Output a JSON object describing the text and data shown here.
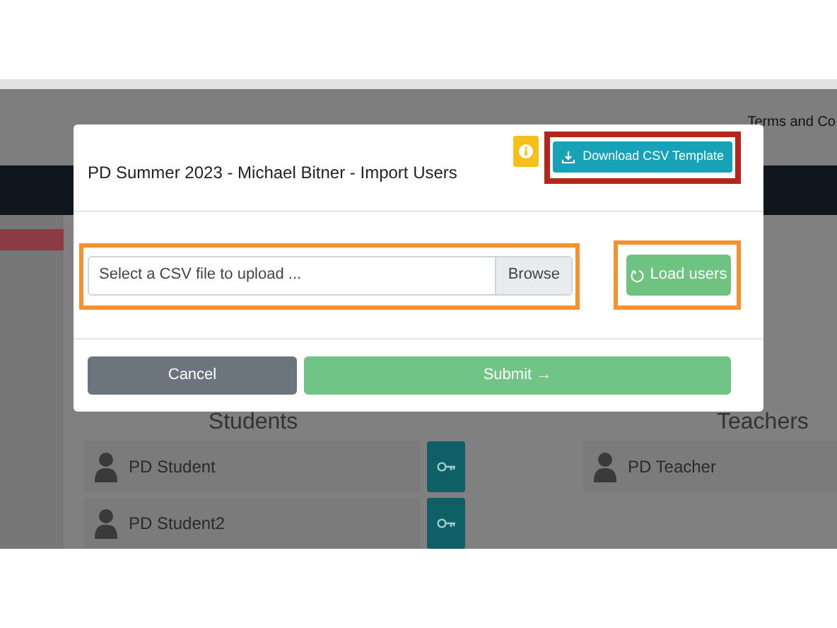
{
  "page": {
    "header_link": "Terms and Co",
    "students_heading": "Students",
    "teachers_heading": "Teachers",
    "students": [
      {
        "name": "PD Student"
      },
      {
        "name": "PD Student2"
      }
    ],
    "teachers": [
      {
        "name": "PD Teacher"
      }
    ]
  },
  "modal": {
    "title": "PD Summer 2023 - Michael Bitner - Import Users",
    "download_button": "Download CSV Template",
    "file_field": {
      "placeholder": "Select a CSV file to upload ...",
      "browse": "Browse"
    },
    "load_button": "Load users",
    "cancel_button": "Cancel",
    "submit_button": "Submit →"
  },
  "annotations": [
    {
      "kind": "download",
      "color": "#b5261a"
    },
    {
      "kind": "file",
      "color": "#f5912f"
    },
    {
      "kind": "load",
      "color": "#f5912f"
    }
  ]
}
